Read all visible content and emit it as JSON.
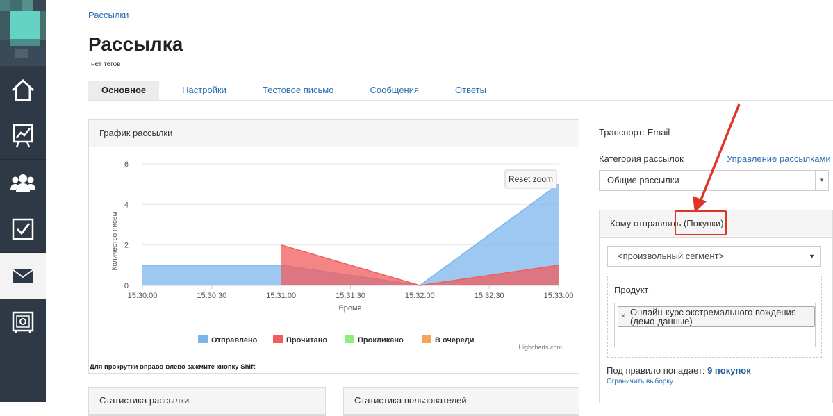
{
  "breadcrumb": "Рассылки",
  "title": "Рассылка",
  "tags": "нет тегов",
  "tabs": [
    {
      "label": "Основное",
      "active": true
    },
    {
      "label": "Настройки",
      "active": false
    },
    {
      "label": "Тестовое письмо",
      "active": false
    },
    {
      "label": "Сообщения",
      "active": false
    },
    {
      "label": "Ответы",
      "active": false
    }
  ],
  "sidebar": {
    "items": [
      {
        "icon": "home-icon"
      },
      {
        "icon": "chart-board-icon"
      },
      {
        "icon": "users-icon"
      },
      {
        "icon": "checkbox-icon"
      },
      {
        "icon": "mail-icon",
        "active": true
      },
      {
        "icon": "safe-icon"
      }
    ]
  },
  "chart_panel": {
    "heading": "График рассылки",
    "reset_zoom": "Reset zoom",
    "credits": "Highcharts.com",
    "hint": "Для прокрутки вправо-влево зажмите кнопку Shift"
  },
  "chart_data": {
    "type": "area",
    "x": [
      "15:30:00",
      "15:31:00",
      "15:32:00",
      "15:33:00"
    ],
    "xticks": [
      "15:30:00",
      "15:30:30",
      "15:31:00",
      "15:31:30",
      "15:32:00",
      "15:32:30",
      "15:33:00"
    ],
    "ylim": [
      0,
      6
    ],
    "yticks": [
      "0",
      "2",
      "4",
      "6"
    ],
    "xlabel": "Время",
    "ylabel": "Количество писем",
    "grid": true,
    "legend_position": "bottom",
    "series": [
      {
        "name": "Отправлено",
        "color": "#7cb5ec",
        "values": [
          1,
          1,
          0,
          5
        ]
      },
      {
        "name": "Прочитано",
        "color": "#f15c5c",
        "values": [
          null,
          2,
          0,
          1
        ]
      },
      {
        "name": "Прокликано",
        "color": "#90ed7d",
        "values": [
          null,
          null,
          null,
          null
        ]
      },
      {
        "name": "В очереди",
        "color": "#f7a35c",
        "values": [
          null,
          null,
          null,
          null
        ]
      }
    ]
  },
  "bottom_panels": {
    "stats_mailing": "Статистика рассылки",
    "stats_users": "Статистика пользователей"
  },
  "right": {
    "transport": "Транспорт: Email",
    "category_label": "Категория рассылок",
    "manage_link": "Управление рассылками",
    "category_value": "Общие рассылки",
    "who_heading": "Кому отправлять (Покупки)",
    "segment_value": "<произвольный сегмент>",
    "product_label": "Продукт",
    "product_chip": "Онлайн-курс экстремального вождения (демо-данные)",
    "rule_text": "Под правило попадает:",
    "rule_count": "9 покупок",
    "limit_link": "Ограничить выборку"
  }
}
